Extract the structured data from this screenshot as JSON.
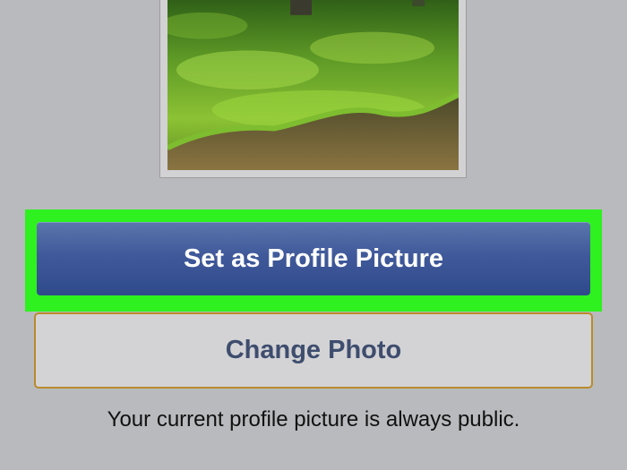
{
  "photo": {
    "description_icon": "landscape-photo-icon"
  },
  "actions": {
    "set_profile_label": "Set as Profile Picture",
    "change_photo_label": "Change Photo"
  },
  "notice": {
    "text": "Your current profile picture is always public."
  },
  "colors": {
    "highlight": "#2ef11f",
    "primary_button": "#40599a",
    "secondary_border": "#b98a2d",
    "background": "#b9babd"
  }
}
